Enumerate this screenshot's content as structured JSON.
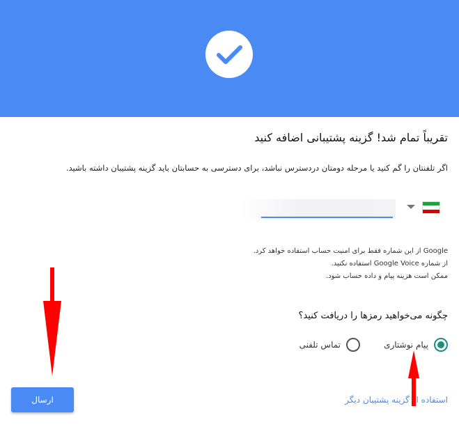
{
  "header": {
    "banner_color": "#4a8af4",
    "icon": "checkmark-icon"
  },
  "main": {
    "title": "تقریباً تمام شد! گزینه پشتیبانی اضافه کنید",
    "subtitle": "اگر تلفنتان را گم کنید یا مرحله دومتان دردسترس نباشد، برای دسترسی به حسابتان باید گزینه پشتیبان داشته باشید."
  },
  "phone": {
    "country": "iran-flag",
    "value": "",
    "placeholder": ""
  },
  "info": {
    "line1": "Google از این شماره فقط برای امنیت حساب استفاده خواهد کرد.",
    "line2": "از شماره Google Voice استفاده نکنید.",
    "line3": "ممکن است هزینه پیام و داده حساب شود."
  },
  "question": "چگونه می‌خواهید رمزها را دریافت کنید؟",
  "options": {
    "sms_label": "پیام نوشتاری",
    "call_label": "تماس تلفنی",
    "selected": "sms"
  },
  "actions": {
    "send_label": "ارسال",
    "alt_link": "استفاده از گزینه پشتیبان دیگر"
  },
  "annotations": {
    "arrow_color": "#ff0000"
  }
}
